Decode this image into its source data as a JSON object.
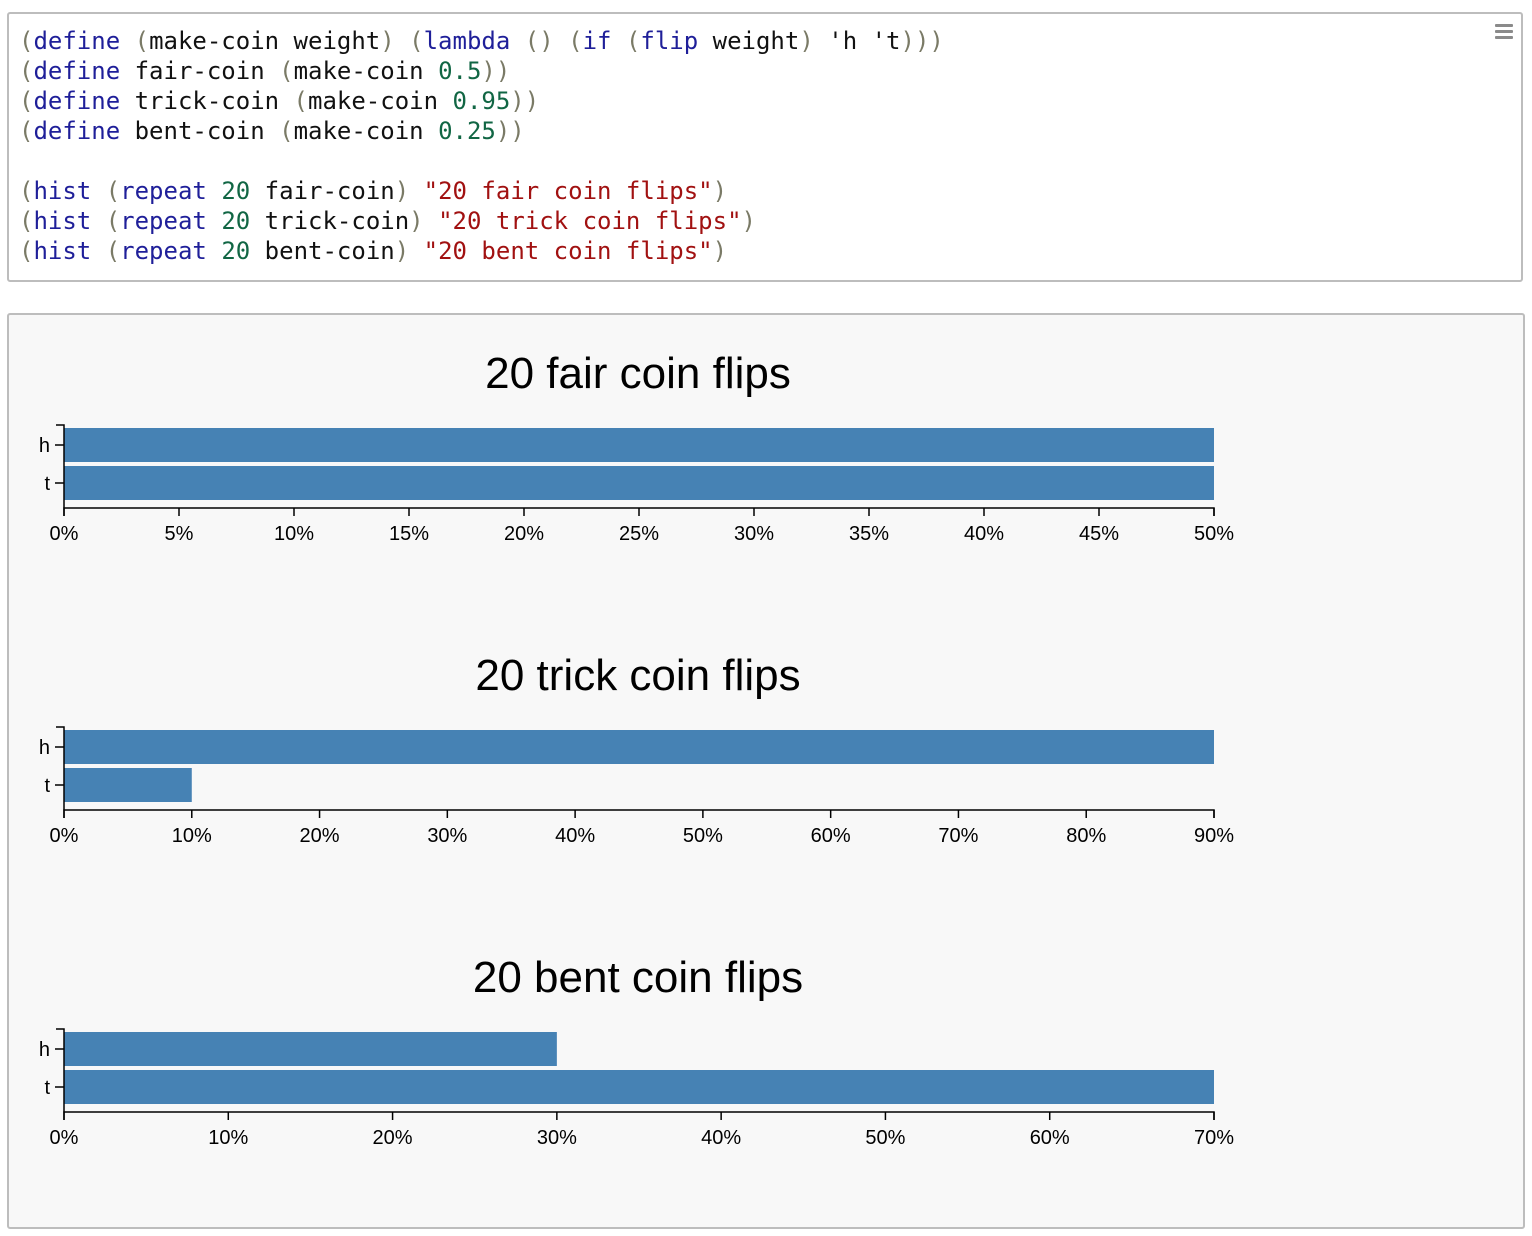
{
  "editor": {
    "code_lines": [
      [
        {
          "t": "(",
          "k": "paren"
        },
        {
          "t": "define",
          "k": "kw"
        },
        {
          "t": " ",
          "k": "sym"
        },
        {
          "t": "(",
          "k": "paren"
        },
        {
          "t": "make-coin weight",
          "k": "sym"
        },
        {
          "t": ")",
          "k": "paren"
        },
        {
          "t": " ",
          "k": "sym"
        },
        {
          "t": "(",
          "k": "paren"
        },
        {
          "t": "lambda",
          "k": "kw"
        },
        {
          "t": " ",
          "k": "sym"
        },
        {
          "t": "()",
          "k": "paren"
        },
        {
          "t": " ",
          "k": "sym"
        },
        {
          "t": "(",
          "k": "paren"
        },
        {
          "t": "if",
          "k": "kw"
        },
        {
          "t": " ",
          "k": "sym"
        },
        {
          "t": "(",
          "k": "paren"
        },
        {
          "t": "flip",
          "k": "kw"
        },
        {
          "t": " weight",
          "k": "sym"
        },
        {
          "t": ")",
          "k": "paren"
        },
        {
          "t": " 'h 't",
          "k": "sym"
        },
        {
          "t": ")))",
          "k": "paren"
        }
      ],
      [
        {
          "t": "(",
          "k": "paren"
        },
        {
          "t": "define",
          "k": "kw"
        },
        {
          "t": " fair-coin ",
          "k": "sym"
        },
        {
          "t": "(",
          "k": "paren"
        },
        {
          "t": "make-coin ",
          "k": "sym"
        },
        {
          "t": "0.5",
          "k": "num"
        },
        {
          "t": "))",
          "k": "paren"
        }
      ],
      [
        {
          "t": "(",
          "k": "paren"
        },
        {
          "t": "define",
          "k": "kw"
        },
        {
          "t": " trick-coin ",
          "k": "sym"
        },
        {
          "t": "(",
          "k": "paren"
        },
        {
          "t": "make-coin ",
          "k": "sym"
        },
        {
          "t": "0.95",
          "k": "num"
        },
        {
          "t": "))",
          "k": "paren"
        }
      ],
      [
        {
          "t": "(",
          "k": "paren"
        },
        {
          "t": "define",
          "k": "kw"
        },
        {
          "t": " bent-coin ",
          "k": "sym"
        },
        {
          "t": "(",
          "k": "paren"
        },
        {
          "t": "make-coin ",
          "k": "sym"
        },
        {
          "t": "0.25",
          "k": "num"
        },
        {
          "t": "))",
          "k": "paren"
        }
      ],
      [],
      [
        {
          "t": "(",
          "k": "paren"
        },
        {
          "t": "hist",
          "k": "kw"
        },
        {
          "t": " ",
          "k": "sym"
        },
        {
          "t": "(",
          "k": "paren"
        },
        {
          "t": "repeat",
          "k": "kw"
        },
        {
          "t": " ",
          "k": "sym"
        },
        {
          "t": "20",
          "k": "num"
        },
        {
          "t": " fair-coin",
          "k": "sym"
        },
        {
          "t": ")",
          "k": "paren"
        },
        {
          "t": " ",
          "k": "sym"
        },
        {
          "t": "\"20 fair coin flips\"",
          "k": "str"
        },
        {
          "t": ")",
          "k": "paren"
        }
      ],
      [
        {
          "t": "(",
          "k": "paren"
        },
        {
          "t": "hist",
          "k": "kw"
        },
        {
          "t": " ",
          "k": "sym"
        },
        {
          "t": "(",
          "k": "paren"
        },
        {
          "t": "repeat",
          "k": "kw"
        },
        {
          "t": " ",
          "k": "sym"
        },
        {
          "t": "20",
          "k": "num"
        },
        {
          "t": " trick-coin",
          "k": "sym"
        },
        {
          "t": ")",
          "k": "paren"
        },
        {
          "t": " ",
          "k": "sym"
        },
        {
          "t": "\"20 trick coin flips\"",
          "k": "str"
        },
        {
          "t": ")",
          "k": "paren"
        }
      ],
      [
        {
          "t": "(",
          "k": "paren"
        },
        {
          "t": "hist",
          "k": "kw"
        },
        {
          "t": " ",
          "k": "sym"
        },
        {
          "t": "(",
          "k": "paren"
        },
        {
          "t": "repeat",
          "k": "kw"
        },
        {
          "t": " ",
          "k": "sym"
        },
        {
          "t": "20",
          "k": "num"
        },
        {
          "t": " bent-coin",
          "k": "sym"
        },
        {
          "t": ")",
          "k": "paren"
        },
        {
          "t": " ",
          "k": "sym"
        },
        {
          "t": "\"20 bent coin flips\"",
          "k": "str"
        },
        {
          "t": ")",
          "k": "paren"
        }
      ]
    ],
    "menu_icon": "hamburger-menu-icon"
  },
  "colors": {
    "bar": "#4682b4",
    "paren": "#7a7a66",
    "keyword": "#1f1f99",
    "number": "#116644",
    "string": "#a11111"
  },
  "chart_data": [
    {
      "type": "bar",
      "orientation": "horizontal",
      "title": "20 fair coin flips",
      "categories": [
        "h",
        "t"
      ],
      "values": [
        50,
        50
      ],
      "xlim": [
        0,
        50
      ],
      "xticks": [
        "0%",
        "5%",
        "10%",
        "15%",
        "20%",
        "25%",
        "30%",
        "35%",
        "40%",
        "45%",
        "50%"
      ]
    },
    {
      "type": "bar",
      "orientation": "horizontal",
      "title": "20 trick coin flips",
      "categories": [
        "h",
        "t"
      ],
      "values": [
        90,
        10
      ],
      "xlim": [
        0,
        90
      ],
      "xticks": [
        "0%",
        "10%",
        "20%",
        "30%",
        "40%",
        "50%",
        "60%",
        "70%",
        "80%",
        "90%"
      ]
    },
    {
      "type": "bar",
      "orientation": "horizontal",
      "title": "20 bent coin flips",
      "categories": [
        "h",
        "t"
      ],
      "values": [
        30,
        70
      ],
      "xlim": [
        0,
        70
      ],
      "xticks": [
        "0%",
        "10%",
        "20%",
        "30%",
        "40%",
        "50%",
        "60%",
        "70%"
      ]
    }
  ]
}
